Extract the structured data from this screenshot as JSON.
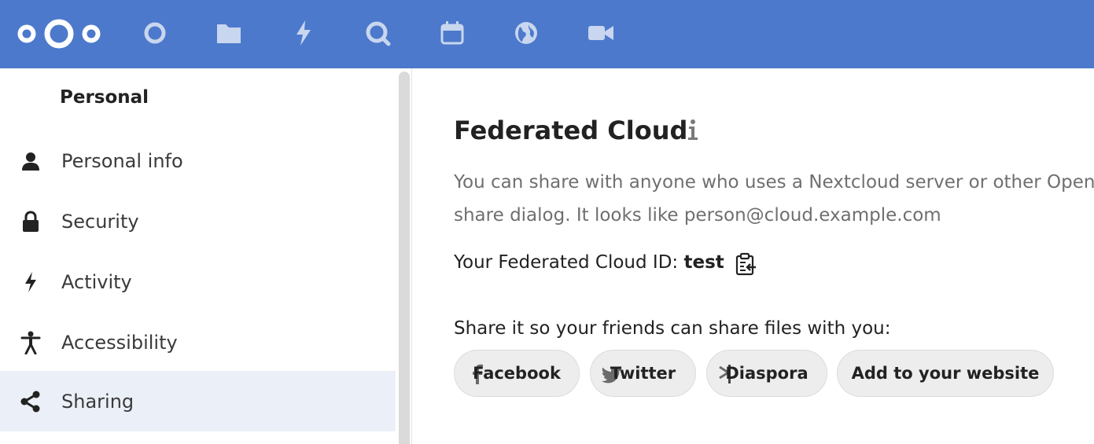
{
  "header": {
    "logo_name": "nextcloud-logo",
    "apps": [
      {
        "name": "dashboard-icon"
      },
      {
        "name": "files-icon"
      },
      {
        "name": "activity-icon"
      },
      {
        "name": "search-icon"
      },
      {
        "name": "calendar-icon"
      },
      {
        "name": "globe-icon"
      },
      {
        "name": "video-icon"
      }
    ],
    "color": "#4c79cb"
  },
  "sidebar": {
    "heading": "Personal",
    "items": [
      {
        "label": "Personal info",
        "icon": "user-icon"
      },
      {
        "label": "Security",
        "icon": "lock-icon"
      },
      {
        "label": "Activity",
        "icon": "bolt-icon"
      },
      {
        "label": "Accessibility",
        "icon": "accessibility-icon"
      },
      {
        "label": "Sharing",
        "icon": "share-icon",
        "active": true
      }
    ]
  },
  "main": {
    "title": "Federated Cloud",
    "description_line1": "You can share with anyone who uses a Nextcloud server or other Open",
    "description_line2": "share dialog. It looks like person@cloud.example.com",
    "cloud_id_label": "Your Federated Cloud ID: ",
    "cloud_id_value": "test",
    "share_prompt": "Share it so your friends can share files with you:",
    "buttons": {
      "facebook": "Facebook",
      "twitter": "Twitter",
      "diaspora": "Diaspora",
      "website": "Add to your website"
    }
  },
  "colors": {
    "accent": "#4c79cb",
    "active_item_bg": "#ebf0f8",
    "muted_text": "#6f6f6f"
  }
}
